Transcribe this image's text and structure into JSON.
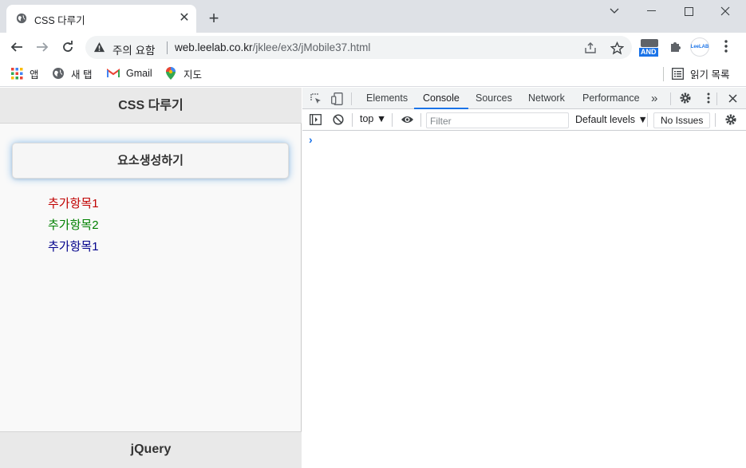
{
  "browser": {
    "tab_title": "CSS 다루기",
    "tab_close_glyph": "✕",
    "new_tab_glyph": "+",
    "security_label": "주의 요함",
    "url_host": "web.leelab.co.kr",
    "url_path": "/jklee/ex3/jMobile37.html",
    "ext_badge": "AND",
    "ext_profile": "LeeLAB",
    "bookmarks": [
      {
        "label": "앱",
        "icon": "apps-grid-icon"
      },
      {
        "label": "새 탭",
        "icon": "globe-icon"
      },
      {
        "label": "Gmail",
        "icon": "gmail-icon"
      },
      {
        "label": "지도",
        "icon": "maps-pin-icon"
      }
    ],
    "reading_list": "읽기 목록"
  },
  "page": {
    "header": "CSS 다루기",
    "button": "요소생성하기",
    "items": [
      {
        "label": "추가항목1",
        "color": "#c00000"
      },
      {
        "label": "추가항목2",
        "color": "#008000"
      },
      {
        "label": "추가항목1",
        "color": "#00008b"
      }
    ],
    "footer": "jQuery"
  },
  "devtools": {
    "tabs": [
      "Elements",
      "Console",
      "Sources",
      "Network",
      "Performance"
    ],
    "active_tab": "Console",
    "more_glyph": "»",
    "context": "top ▼",
    "filter_placeholder": "Filter",
    "levels": "Default levels ▼",
    "issues": "No Issues",
    "prompt": "›"
  },
  "colors": {
    "accent": "#1a73e8",
    "tabstrip": "#dee1e6"
  }
}
